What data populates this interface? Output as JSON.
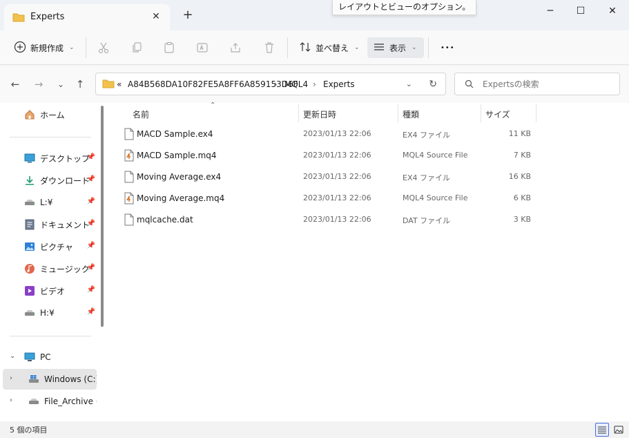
{
  "window": {
    "tab_title": "Experts",
    "new_tab_glyph": "+",
    "close_tab_glyph": "✕",
    "tooltip": "レイアウトとビューのオプション。",
    "minimize_glyph": "─",
    "maximize_glyph": "☐",
    "close_glyph": "✕"
  },
  "toolbar": {
    "new_label": "新規作成",
    "sort_label": "並べ替え",
    "view_label": "表示",
    "more_glyph": "•••",
    "cut_icon": "scissors-icon",
    "copy_icon": "copy-icon",
    "paste_icon": "paste-icon",
    "rename_icon": "rename-icon",
    "share_icon": "share-icon",
    "delete_icon": "trash-icon"
  },
  "nav": {
    "back_glyph": "←",
    "forward_glyph": "→",
    "recent_glyph": "⌄",
    "up_glyph": "↑",
    "overflow_glyph": "«",
    "breadcrumbs": [
      "A84B568DA10F82FE5A8FF6A859153D6F",
      "MQL4",
      "Experts"
    ],
    "crumb_separator": "›",
    "search_placeholder": "Expertsの検索"
  },
  "sidebar": {
    "home": "ホーム",
    "quick_access": [
      {
        "label": "デスクトップ",
        "icon": "desktop-icon"
      },
      {
        "label": "ダウンロード",
        "icon": "download-icon"
      },
      {
        "label": "L:¥",
        "icon": "drive-icon"
      },
      {
        "label": "ドキュメント",
        "icon": "document-icon"
      },
      {
        "label": "ピクチャ",
        "icon": "picture-icon"
      },
      {
        "label": "ミュージック",
        "icon": "music-icon"
      },
      {
        "label": "ビデオ",
        "icon": "video-icon"
      },
      {
        "label": "H:¥",
        "icon": "drive-icon"
      }
    ],
    "pc": "PC",
    "drives": [
      {
        "label": "Windows (C:)",
        "selected": true
      },
      {
        "label": "File_Archive (D:)",
        "selected": false
      }
    ]
  },
  "columns": {
    "name": "名前",
    "date": "更新日時",
    "type": "種類",
    "size": "サイズ",
    "sort_glyph": "⌃"
  },
  "files": [
    {
      "name": "MACD Sample.ex4",
      "date": "2023/01/13 22:06",
      "type": "EX4 ファイル",
      "size": "11 KB",
      "icon": "file-icon"
    },
    {
      "name": "MACD Sample.mq4",
      "date": "2023/01/13 22:06",
      "type": "MQL4 Source File",
      "size": "7 KB",
      "icon": "mq4-file-icon"
    },
    {
      "name": "Moving Average.ex4",
      "date": "2023/01/13 22:06",
      "type": "EX4 ファイル",
      "size": "16 KB",
      "icon": "file-icon"
    },
    {
      "name": "Moving Average.mq4",
      "date": "2023/01/13 22:06",
      "type": "MQL4 Source File",
      "size": "6 KB",
      "icon": "mq4-file-icon"
    },
    {
      "name": "mqlcache.dat",
      "date": "2023/01/13 22:06",
      "type": "DAT ファイル",
      "size": "3 KB",
      "icon": "file-icon"
    }
  ],
  "status": {
    "item_count": "5 個の項目"
  },
  "colors": {
    "folder": "#f2c14e",
    "accent": "#4a6cd8"
  }
}
